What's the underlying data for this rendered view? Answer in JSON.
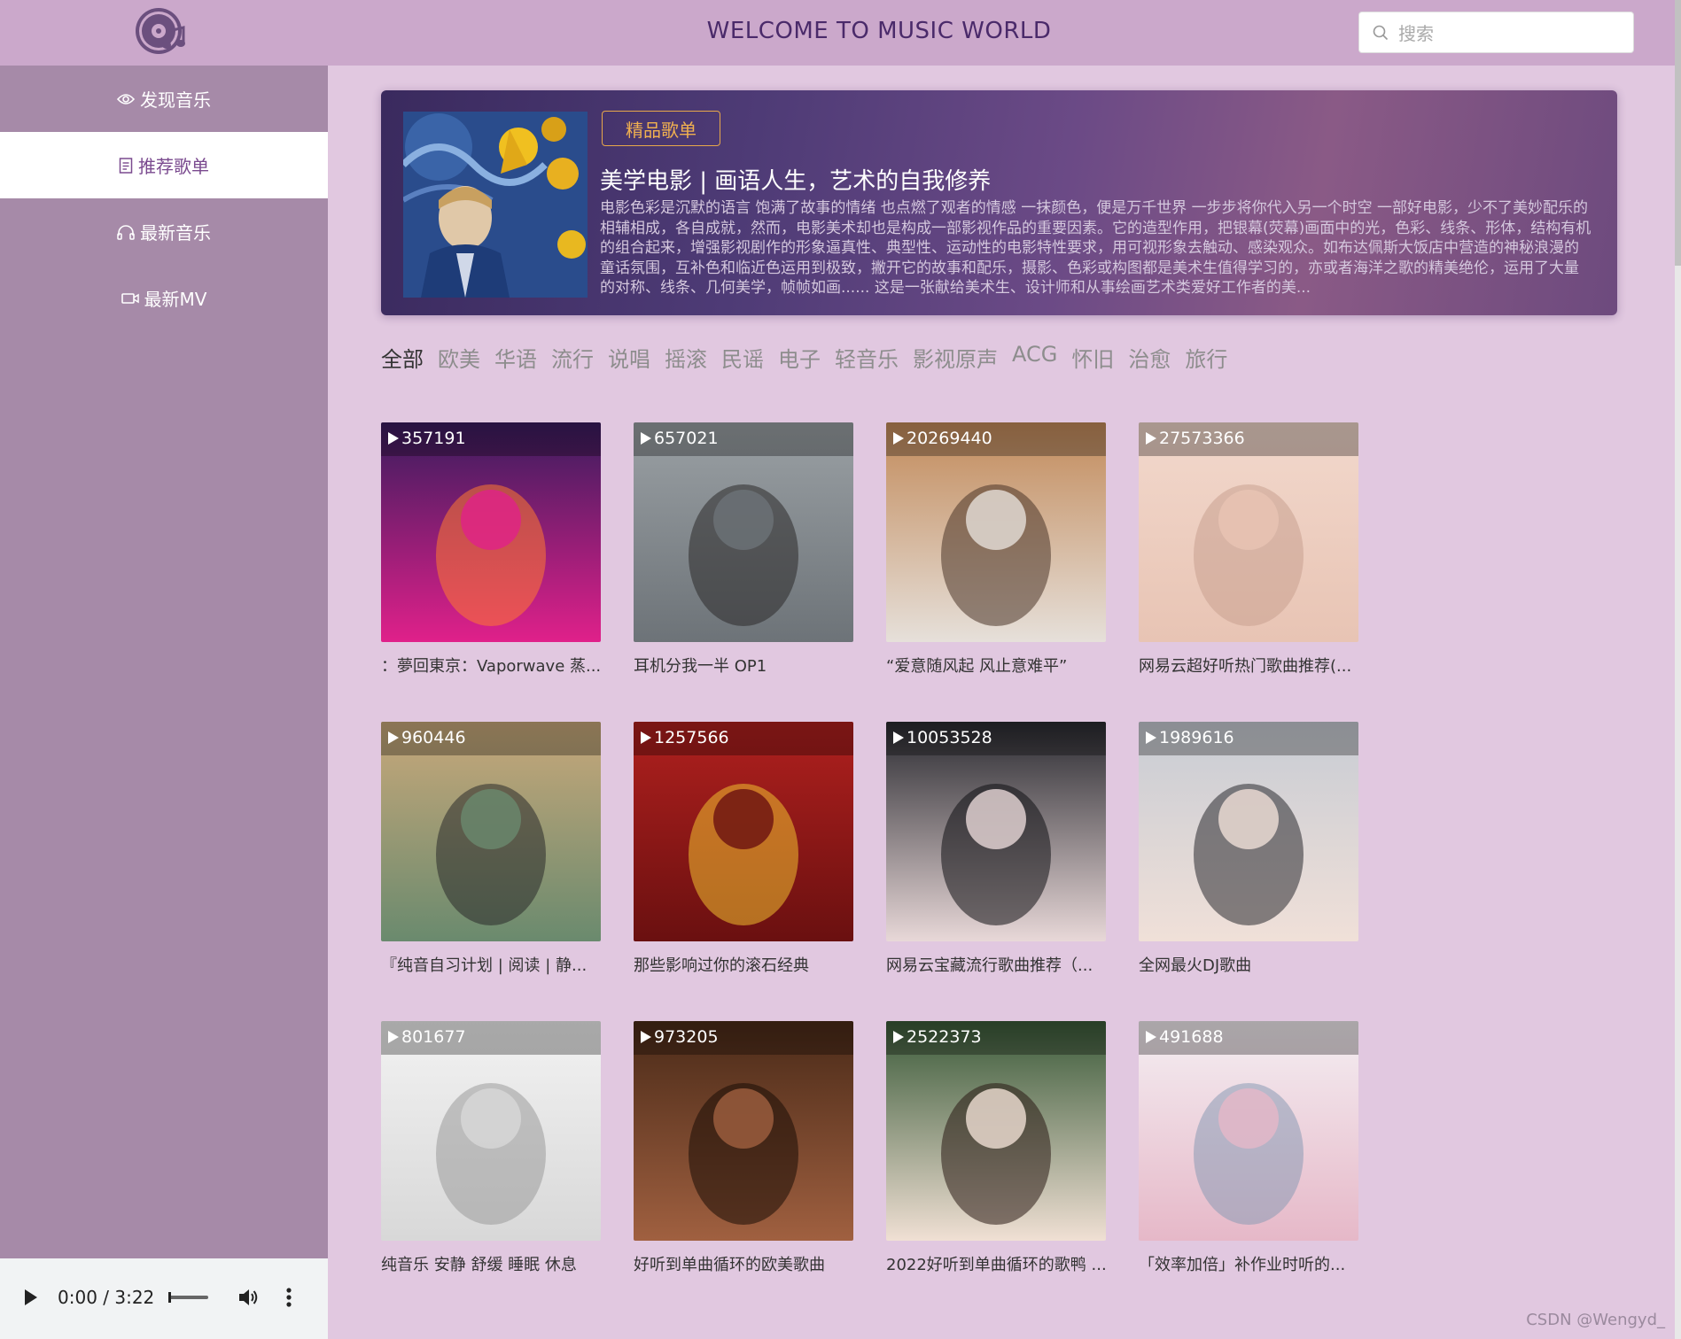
{
  "header": {
    "title": "WELCOME TO MUSIC WORLD",
    "search_placeholder": "搜索"
  },
  "sidebar": {
    "items": [
      {
        "label": "发现音乐",
        "icon": "eye-icon",
        "active": false
      },
      {
        "label": "推荐歌单",
        "icon": "document-icon",
        "active": true
      },
      {
        "label": "最新音乐",
        "icon": "headphones-icon",
        "active": false
      },
      {
        "label": "最新MV",
        "icon": "video-icon",
        "active": false
      }
    ]
  },
  "banner": {
    "badge": "精品歌单",
    "title": "美学电影 | 画语人生，艺术的自我修养",
    "description": "电影色彩是沉默的语言 饱满了故事的情绪 也点燃了观者的情感 一抹颜色，便是万千世界 一步步将你代入另一个时空 一部好电影，少不了美妙配乐的相辅相成，各自成就，然而，电影美术却也是构成一部影视作品的重要因素。它的造型作用，把银幕(荧幕)画面中的光，色彩、线条、形体，结构有机的组合起来，增强影视剧作的形象逼真性、典型性、运动性的电影特性要求，用可视形象去触动、感染观众。如布达佩斯大饭店中营造的神秘浪漫的童话氛围，互补色和临近色运用到极致，撇开它的故事和配乐，摄影、色彩或构图都是美术生值得学习的，亦或者海洋之歌的精美绝伦，运用了大量的对称、线条、几何美学，帧帧如画...... 这是一张献给美术生、设计师和从事绘画艺术类爱好工作者的美..."
  },
  "tags": [
    {
      "label": "全部",
      "active": true
    },
    {
      "label": "欧美",
      "active": false
    },
    {
      "label": "华语",
      "active": false
    },
    {
      "label": "流行",
      "active": false
    },
    {
      "label": "说唱",
      "active": false
    },
    {
      "label": "摇滚",
      "active": false
    },
    {
      "label": "民谣",
      "active": false
    },
    {
      "label": "电子",
      "active": false
    },
    {
      "label": "轻音乐",
      "active": false
    },
    {
      "label": "影视原声",
      "active": false
    },
    {
      "label": "ACG",
      "active": false
    },
    {
      "label": "怀旧",
      "active": false
    },
    {
      "label": "治愈",
      "active": false
    },
    {
      "label": "旅行",
      "active": false
    }
  ],
  "playlists": [
    {
      "count": "357191",
      "title": "：夢回東京：Vaporwave 蒸...",
      "colors": [
        "#3a1c5e",
        "#e0208a",
        "#ff7a30"
      ]
    },
    {
      "count": "657021",
      "title": "耳机分我一半 OP1",
      "colors": [
        "#9aa0a4",
        "#6d7378",
        "#2c2a2a"
      ]
    },
    {
      "count": "20269440",
      "title": "“爱意随风起 风止意难平”",
      "colors": [
        "#c28a5a",
        "#e6e0da",
        "#4a3528"
      ]
    },
    {
      "count": "27573366",
      "title": "网易云超好听热门歌曲推荐(...",
      "colors": [
        "#f2d8cc",
        "#e8c4b4",
        "#c9a090"
      ]
    },
    {
      "count": "960446",
      "title": "『纯音自习计划 | 阅读 |  静...",
      "colors": [
        "#c8a87a",
        "#6a8a6e",
        "#2a2a2a"
      ]
    },
    {
      "count": "1257566",
      "title": "那些影响过你的滚石经典",
      "colors": [
        "#b0201e",
        "#6a1010",
        "#f0c030"
      ]
    },
    {
      "count": "10053528",
      "title": "网易云宝藏流行歌曲推荐（...",
      "colors": [
        "#2a2a30",
        "#e8d8d8",
        "#101014"
      ]
    },
    {
      "count": "1989616",
      "title": "全网最火DJ歌曲",
      "colors": [
        "#c8ccd4",
        "#f0e0d8",
        "#2a2a30"
      ]
    },
    {
      "count": "801677",
      "title": "纯音乐 安静 舒缓 睡眠 休息",
      "colors": [
        "#f2f2f2",
        "#d8d8d8",
        "#9a9a9a"
      ]
    },
    {
      "count": "973205",
      "title": "好听到单曲循环的欧美歌曲",
      "colors": [
        "#4a2a18",
        "#a06040",
        "#1a0c06"
      ]
    },
    {
      "count": "2522373",
      "title": "2022好听到单曲循环的歌鸭 ...",
      "colors": [
        "#3a5a38",
        "#f0e0d4",
        "#2a1a14"
      ]
    },
    {
      "count": "491688",
      "title": "「效率加倍」补作业时听的...",
      "colors": [
        "#f4eef2",
        "#e6b8c8",
        "#8a9ab4"
      ]
    }
  ],
  "player": {
    "time": "0:00 / 3:22"
  },
  "watermark": "CSDN @Wengyd_"
}
